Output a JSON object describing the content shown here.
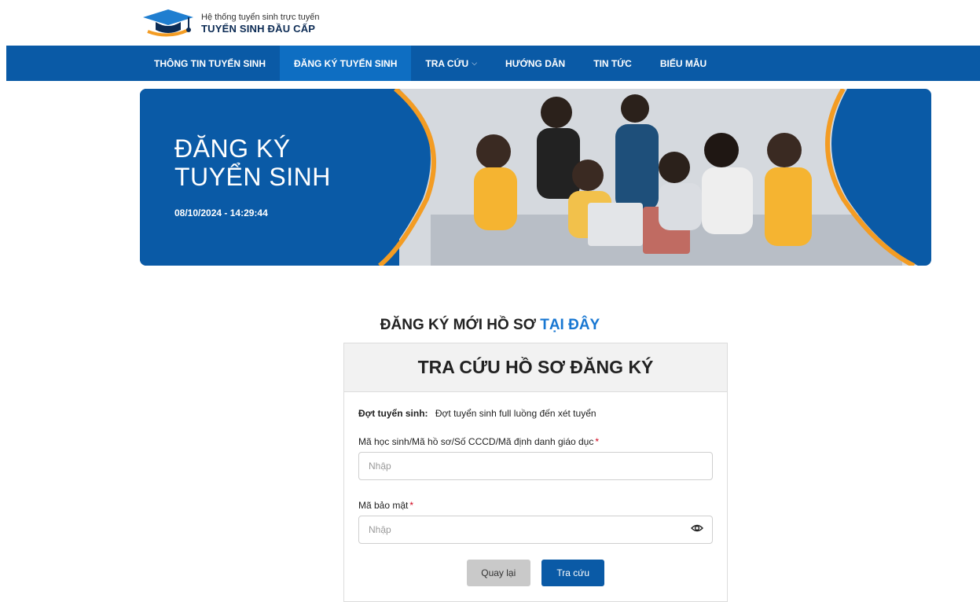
{
  "header": {
    "logo_subtitle": "Hệ thống tuyển sinh trực tuyến",
    "logo_title": "TUYỂN SINH ĐẦU CẤP"
  },
  "nav": {
    "items": [
      {
        "label": "THÔNG TIN TUYỂN SINH"
      },
      {
        "label": "ĐĂNG KÝ TUYỂN SINH"
      },
      {
        "label": "TRA CỨU"
      },
      {
        "label": "HƯỚNG DẪN"
      },
      {
        "label": "TIN TỨC"
      },
      {
        "label": "BIỂU MẪU"
      }
    ]
  },
  "banner": {
    "title_line1": "ĐĂNG KÝ",
    "title_line2": "TUYỂN SINH",
    "datetime": "08/10/2024 - 14:29:44"
  },
  "register": {
    "prefix": "ĐĂNG KÝ MỚI HỒ SƠ",
    "link": "TẠI ĐÂY"
  },
  "card": {
    "title": "TRA CỨU HỒ SƠ ĐĂNG KÝ",
    "round_label": "Đợt tuyển sinh:",
    "round_value": "Đợt tuyển sinh full luồng đến xét tuyển",
    "id_label": "Mã học sinh/Mã hồ sơ/Số CCCD/Mã định danh giáo dục",
    "id_placeholder": "Nhập",
    "security_label": "Mã bảo mật",
    "security_placeholder": "Nhập",
    "required_mark": "*",
    "back_button": "Quay lại",
    "search_button": "Tra cứu"
  },
  "colors": {
    "primary": "#0a5aa6",
    "active_nav": "#0e6ec2",
    "accent_orange": "#f39c23",
    "link_blue": "#1877d2",
    "required_red": "#d0021b"
  }
}
